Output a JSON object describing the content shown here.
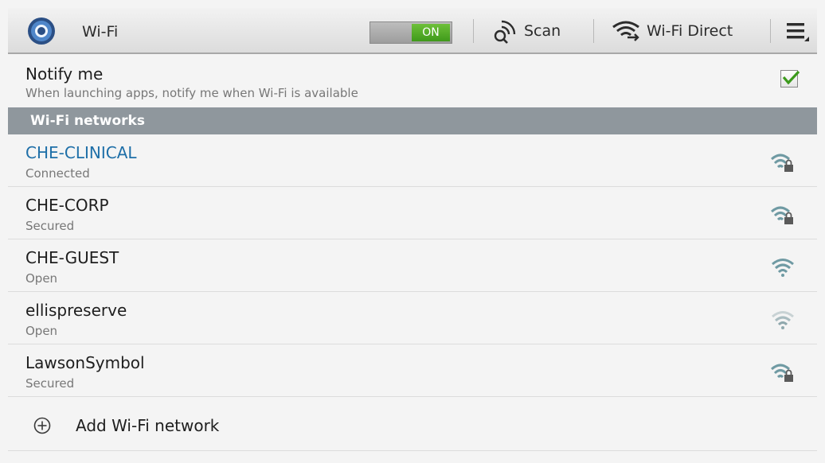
{
  "actionbar": {
    "app_icon": "wifi-settings-icon",
    "title": "Wi-Fi",
    "toggle_label": "ON",
    "scan_label": "Scan",
    "scan_icon": "scan-icon",
    "direct_label": "Wi-Fi Direct",
    "direct_icon": "wifi-direct-icon",
    "menu_icon": "overflow-menu-icon"
  },
  "notify": {
    "title": "Notify me",
    "subtitle": "When launching apps, notify me when Wi-Fi is available",
    "checked": true
  },
  "section": {
    "label": "Wi-Fi networks"
  },
  "networks": [
    {
      "name": "CHE-CLINICAL",
      "status": "Connected",
      "secured": true,
      "connected": true
    },
    {
      "name": "CHE-CORP",
      "status": "Secured",
      "secured": true,
      "connected": false
    },
    {
      "name": "CHE-GUEST",
      "status": "Open",
      "secured": false,
      "connected": false
    },
    {
      "name": "ellispreserve",
      "status": "Open",
      "secured": false,
      "connected": false,
      "weak": true
    },
    {
      "name": "LawsonSymbol",
      "status": "Secured",
      "secured": true,
      "connected": false
    }
  ],
  "add_network": {
    "label": "Add Wi-Fi network",
    "icon": "add-circle-icon"
  },
  "colors": {
    "accent": "#1e6fa8",
    "toggle_on": "#4ea924",
    "section_bg": "#8f979d",
    "signal": "#6f9aa3"
  }
}
